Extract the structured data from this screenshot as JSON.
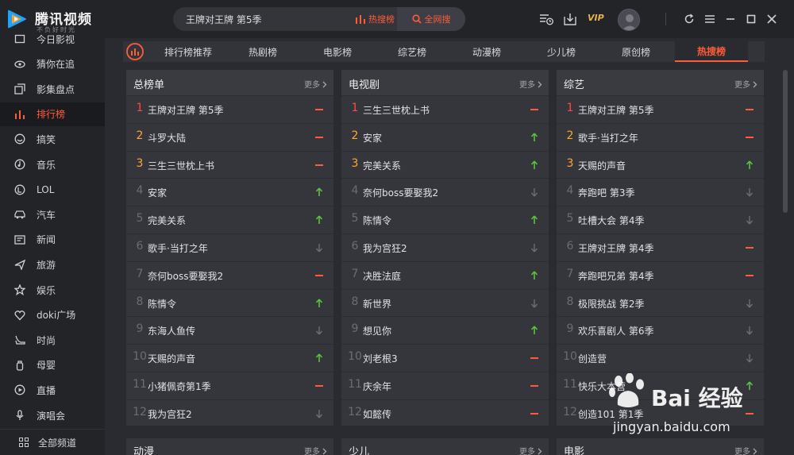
{
  "app": {
    "name": "腾讯视频",
    "tagline": "不负好时光",
    "vip_label": "VIP"
  },
  "search": {
    "value": "王牌对王牌 第5季",
    "hot_search_label": "热搜榜",
    "all_search_label": "全网搜"
  },
  "colors": {
    "accent": "#ff5c38",
    "rank1": "#ff4a3d",
    "rank23": "#ffa530",
    "trend_up": "#5fbf3f",
    "trend_same": "#ff5a3c",
    "trend_down": "#6c6d72"
  },
  "sidebar": {
    "items": [
      {
        "label": "今日影视",
        "icon": "film-icon"
      },
      {
        "label": "猜你在追",
        "icon": "eye-icon"
      },
      {
        "label": "影集盘点",
        "icon": "stack-icon"
      },
      {
        "label": "排行榜",
        "icon": "bar-chart-icon",
        "active": true
      },
      {
        "label": "搞笑",
        "icon": "smile-icon"
      },
      {
        "label": "音乐",
        "icon": "music-icon"
      },
      {
        "label": "LOL",
        "icon": "lol-icon"
      },
      {
        "label": "汽车",
        "icon": "car-icon"
      },
      {
        "label": "新闻",
        "icon": "news-icon"
      },
      {
        "label": "旅游",
        "icon": "plane-icon"
      },
      {
        "label": "娱乐",
        "icon": "star-icon"
      },
      {
        "label": "doki广场",
        "icon": "heart-icon"
      },
      {
        "label": "时尚",
        "icon": "heel-icon"
      },
      {
        "label": "母婴",
        "icon": "bottle-icon"
      },
      {
        "label": "直播",
        "icon": "live-icon"
      },
      {
        "label": "演唱会",
        "icon": "mic-icon"
      }
    ],
    "bottom_label": "全部频道"
  },
  "tabs": [
    {
      "label": "排行榜推荐"
    },
    {
      "label": "热剧榜"
    },
    {
      "label": "电影榜"
    },
    {
      "label": "综艺榜"
    },
    {
      "label": "动漫榜"
    },
    {
      "label": "少儿榜"
    },
    {
      "label": "原创榜"
    },
    {
      "label": "热搜榜",
      "active": true
    }
  ],
  "panels": [
    {
      "title": "总榜单",
      "more": "更多",
      "rows": [
        {
          "rank": "1",
          "title": "王牌对王牌 第5季",
          "trend": "same"
        },
        {
          "rank": "2",
          "title": "斗罗大陆",
          "trend": "same"
        },
        {
          "rank": "3",
          "title": "三生三世枕上书",
          "trend": "same"
        },
        {
          "rank": "4",
          "title": "安家",
          "trend": "up"
        },
        {
          "rank": "5",
          "title": "完美关系",
          "trend": "up"
        },
        {
          "rank": "6",
          "title": "歌手·当打之年",
          "trend": "down"
        },
        {
          "rank": "7",
          "title": "奈何boss要娶我2",
          "trend": "same"
        },
        {
          "rank": "8",
          "title": "陈情令",
          "trend": "up"
        },
        {
          "rank": "9",
          "title": "东海人鱼传",
          "trend": "down"
        },
        {
          "rank": "10",
          "title": "天赐的声音",
          "trend": "up"
        },
        {
          "rank": "11",
          "title": "小猪佩奇第1季",
          "trend": "same"
        },
        {
          "rank": "12",
          "title": "我为宫狂2",
          "trend": "down"
        }
      ]
    },
    {
      "title": "电视剧",
      "more": "更多",
      "rows": [
        {
          "rank": "1",
          "title": "三生三世枕上书",
          "trend": "same"
        },
        {
          "rank": "2",
          "title": "安家",
          "trend": "up"
        },
        {
          "rank": "3",
          "title": "完美关系",
          "trend": "up"
        },
        {
          "rank": "4",
          "title": "奈何boss要娶我2",
          "trend": "down"
        },
        {
          "rank": "5",
          "title": "陈情令",
          "trend": "up"
        },
        {
          "rank": "6",
          "title": "我为宫狂2",
          "trend": "down"
        },
        {
          "rank": "7",
          "title": "决胜法庭",
          "trend": "up"
        },
        {
          "rank": "8",
          "title": "新世界",
          "trend": "down"
        },
        {
          "rank": "9",
          "title": "想见你",
          "trend": "up"
        },
        {
          "rank": "10",
          "title": "刘老根3",
          "trend": "same"
        },
        {
          "rank": "11",
          "title": "庆余年",
          "trend": "same"
        },
        {
          "rank": "12",
          "title": "如懿传",
          "trend": "same"
        }
      ]
    },
    {
      "title": "综艺",
      "more": "更多",
      "rows": [
        {
          "rank": "1",
          "title": "王牌对王牌 第5季",
          "trend": "same"
        },
        {
          "rank": "2",
          "title": "歌手·当打之年",
          "trend": "same"
        },
        {
          "rank": "3",
          "title": "天赐的声音",
          "trend": "up"
        },
        {
          "rank": "4",
          "title": "奔跑吧 第3季",
          "trend": "down"
        },
        {
          "rank": "5",
          "title": "吐槽大会 第4季",
          "trend": "down"
        },
        {
          "rank": "6",
          "title": "王牌对王牌 第4季",
          "trend": "same"
        },
        {
          "rank": "7",
          "title": "奔跑吧兄弟 第4季",
          "trend": "same"
        },
        {
          "rank": "8",
          "title": "极限挑战 第2季",
          "trend": "down"
        },
        {
          "rank": "9",
          "title": "欢乐喜剧人 第6季",
          "trend": "down"
        },
        {
          "rank": "10",
          "title": "创造营",
          "trend": "down"
        },
        {
          "rank": "11",
          "title": "快乐大本营",
          "trend": "up"
        },
        {
          "rank": "12",
          "title": "创造101 第1季",
          "trend": "same"
        }
      ]
    }
  ],
  "bottom_panels": [
    {
      "title": "动漫",
      "more": "更多"
    },
    {
      "title": "少儿",
      "more": "更多"
    },
    {
      "title": "电影",
      "more": "更多"
    }
  ],
  "watermark": {
    "brand": "Bai  经验",
    "url": "jingyan.baidu.com"
  }
}
